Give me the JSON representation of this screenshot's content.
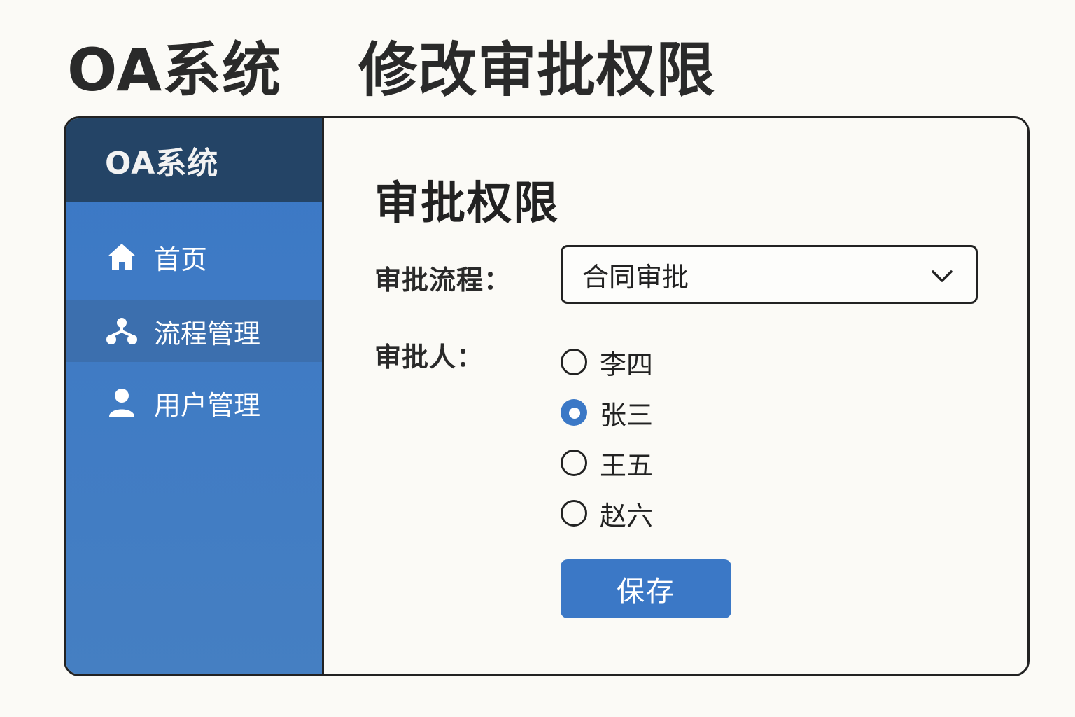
{
  "page": {
    "system_title": "OA系统",
    "page_subject": "修改审批权限"
  },
  "sidebar": {
    "logo_text": "OA系统",
    "items": [
      {
        "label": "首页",
        "icon": "home-icon",
        "active": false
      },
      {
        "label": "流程管理",
        "icon": "workflow-icon",
        "active": true
      },
      {
        "label": "用户管理",
        "icon": "user-icon",
        "active": false
      }
    ]
  },
  "main": {
    "title": "审批权限",
    "process_label": "审批流程：",
    "process_value": "合同审批",
    "approver_label": "审批人：",
    "approvers": [
      {
        "name": "李四",
        "checked": false
      },
      {
        "name": "张三",
        "checked": true
      },
      {
        "name": "王五",
        "checked": false
      },
      {
        "name": "赵六",
        "checked": false
      }
    ],
    "save_label": "保存"
  },
  "colors": {
    "accent": "#3b78c6",
    "sidebar_header": "#244466",
    "sidebar_active": "#3c6fae",
    "background": "#fbfaf6"
  }
}
